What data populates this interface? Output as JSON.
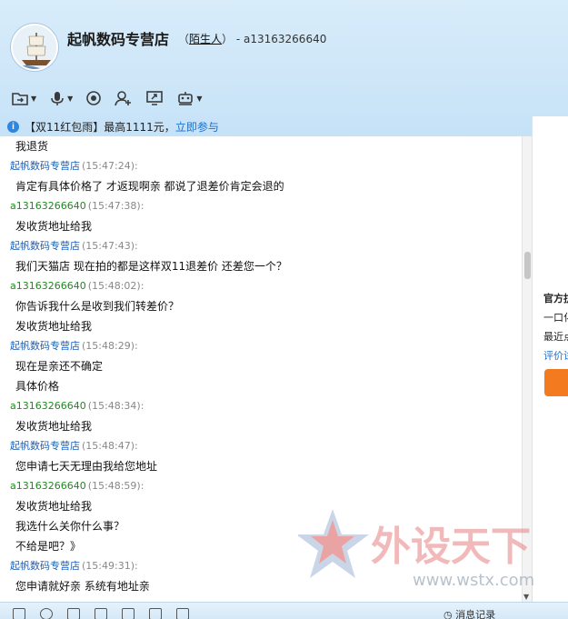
{
  "header": {
    "shop_name": "起帆数码专营店",
    "open_paren": "（",
    "relation": "陌生人",
    "close_paren": "）",
    "account": " - a13163266640"
  },
  "toolbar": {
    "icons": [
      "folder-transfer-icon",
      "microphone-icon",
      "camera-icon",
      "add-contact-icon",
      "screen-share-icon",
      "remote-assist-icon"
    ]
  },
  "notice": {
    "icon": "i",
    "text": "【双11红包雨】最高1111元，",
    "link": "立即参与"
  },
  "right_panel": {
    "line1": "官方抗",
    "line2": "一口化",
    "line3": "最近点",
    "line4": "评价试"
  },
  "chat": {
    "first_line": "我退货",
    "messages": [
      {
        "sender": "起帆数码专营店",
        "role": "shop",
        "time": "(15:47:24):",
        "lines": [
          "肯定有具体价格了 才返现啊亲 都说了退差价肯定会退的"
        ]
      },
      {
        "sender": "a13163266640",
        "role": "user",
        "time": "(15:47:38):",
        "lines": [
          "发收货地址给我"
        ]
      },
      {
        "sender": "起帆数码专营店",
        "role": "shop",
        "time": "(15:47:43):",
        "lines": [
          "我们天猫店 现在拍的都是这样双11退差价 还差您一个？"
        ]
      },
      {
        "sender": "a13163266640",
        "role": "user",
        "time": "(15:48:02):",
        "lines": [
          "你告诉我什么是收到我们转差价？",
          "发收货地址给我"
        ]
      },
      {
        "sender": "起帆数码专营店",
        "role": "shop",
        "time": "(15:48:29):",
        "lines": [
          "现在是亲还不确定",
          "具体价格"
        ]
      },
      {
        "sender": "a13163266640",
        "role": "user",
        "time": "(15:48:34):",
        "lines": [
          "发收货地址给我"
        ]
      },
      {
        "sender": "起帆数码专营店",
        "role": "shop",
        "time": "(15:48:47):",
        "lines": [
          "您申请七天无理由我给您地址"
        ]
      },
      {
        "sender": "a13163266640",
        "role": "user",
        "time": "(15:48:59):",
        "lines": [
          "发收货地址给我",
          "我选什么关你什么事？",
          "不给是吧？》"
        ]
      },
      {
        "sender": "起帆数码专营店",
        "role": "shop",
        "time": "(15:49:31):",
        "lines": [
          "您申请就好亲 系统有地址亲"
        ]
      }
    ]
  },
  "bottom": {
    "message_record": "消息记录"
  },
  "watermark": {
    "main": "外设天下",
    "url": "www.wstx.com"
  },
  "colors": {
    "shop_name": "#1e5fb4",
    "user_name": "#1f8a1f",
    "link": "#1e6fcc",
    "accent_orange": "#f47a20"
  }
}
